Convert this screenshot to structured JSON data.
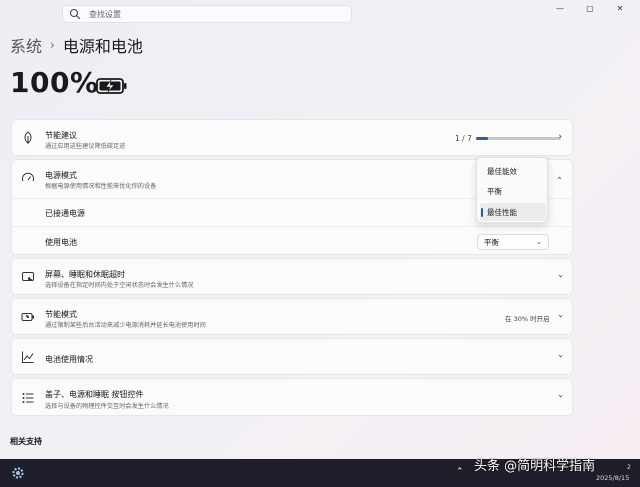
{
  "search": {
    "placeholder": "查找设置"
  },
  "window_controls": {
    "minimize": "—",
    "maximize": "▢",
    "close": "✕"
  },
  "breadcrumb": {
    "parent": "系统",
    "separator": "›",
    "current": "电源和电池"
  },
  "battery": {
    "percent": "100%",
    "charge_level": 1.0
  },
  "cards": {
    "energy_tips": {
      "title": "节能建议",
      "subtitle": "通过应用这些建议降低碳足迹",
      "progress_text": "1 / 7",
      "progress_fraction": 0.143
    },
    "power_mode": {
      "title": "电源模式",
      "subtitle": "根据电源使用情况和性能来优化你的设备",
      "plugged_in_label": "已接通电源",
      "on_battery_label": "使用电池",
      "on_battery_value": "平衡"
    },
    "screen_sleep": {
      "title": "屏幕、睡眠和休眠超时",
      "subtitle": "选择设备在指定时间内处于空闲状态时会发生什么情况"
    },
    "energy_saver": {
      "title": "节能模式",
      "subtitle": "通过限制某些后台活动来减少电源消耗并延长电池使用时间",
      "status": "在 30% 时开启"
    },
    "battery_usage": {
      "title": "电池使用情况"
    },
    "lid_power": {
      "title": "盖子、电源和睡眠 按钮控件",
      "subtitle": "选择与设备的物理控件交互时会发生什么情况"
    }
  },
  "power_mode_menu": {
    "options": [
      "最佳能效",
      "平衡",
      "最佳性能"
    ],
    "selected_index": 2
  },
  "related": {
    "title": "相关支持"
  },
  "taskbar": {
    "watermark": "头条 @简明科学指南",
    "date": "2025/8/15",
    "tray_number": "2"
  },
  "colors": {
    "accent": "#2f5f96",
    "taskbar": "#1f1f2b"
  }
}
